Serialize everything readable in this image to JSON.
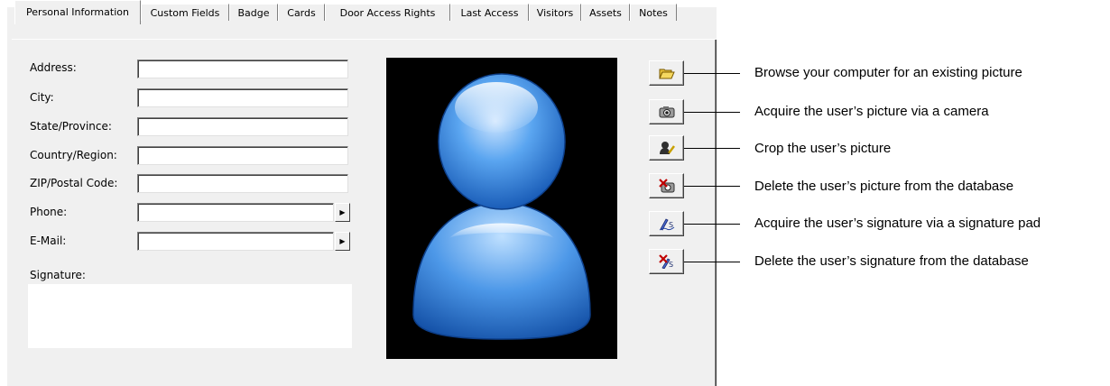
{
  "tabs": [
    {
      "label": "Personal Information",
      "active": true
    },
    {
      "label": "Custom Fields"
    },
    {
      "label": "Badge"
    },
    {
      "label": "Cards"
    },
    {
      "label": "Door Access Rights"
    },
    {
      "label": "Last Access"
    },
    {
      "label": "Visitors"
    },
    {
      "label": "Assets"
    },
    {
      "label": "Notes"
    }
  ],
  "form": {
    "address": {
      "label": "Address:",
      "value": ""
    },
    "city": {
      "label": "City:",
      "value": ""
    },
    "state": {
      "label": "State/Province:",
      "value": ""
    },
    "country": {
      "label": "Country/Region:",
      "value": ""
    },
    "zip": {
      "label": "ZIP/Postal Code:",
      "value": ""
    },
    "phone": {
      "label": "Phone:",
      "value": ""
    },
    "email": {
      "label": "E-Mail:",
      "value": ""
    },
    "signature_label": "Signature:"
  },
  "photo": {
    "icon": "user-silhouette-icon"
  },
  "buttons": [
    {
      "icon": "open-folder-icon",
      "callout": "Browse your computer for an existing picture"
    },
    {
      "icon": "camera-icon",
      "callout": "Acquire the user’s picture via a camera"
    },
    {
      "icon": "crop-picture-icon",
      "callout": "Crop the user’s picture"
    },
    {
      "icon": "delete-picture-icon",
      "callout": "Delete the user’s picture from the database"
    },
    {
      "icon": "signature-pad-icon",
      "callout": "Acquire the user’s signature via a signature pad"
    },
    {
      "icon": "delete-signature-icon",
      "callout": "Delete the user’s signature from the database"
    }
  ],
  "colors": {
    "panel": "#f0f0f0",
    "photo_bg": "#000000",
    "user_blue": "#3a8ae0",
    "delete_red": "#c00000"
  }
}
